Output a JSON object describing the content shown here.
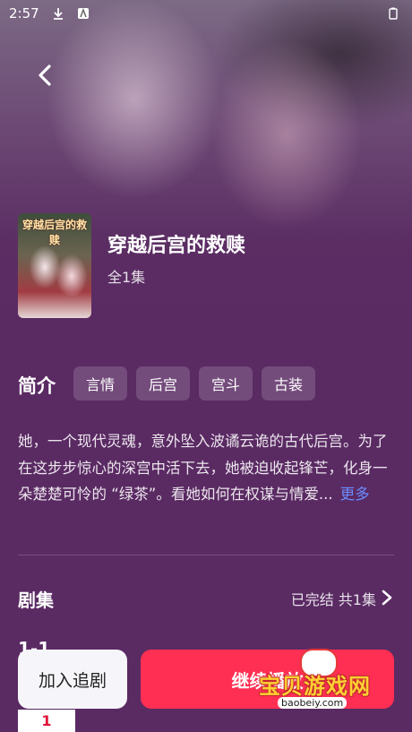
{
  "status": {
    "time": "2:57"
  },
  "drama": {
    "title": "穿越后宫的救赎",
    "cover_title": "穿越后宫的救赎",
    "episodes": "全1集"
  },
  "intro": {
    "label": "简介",
    "tags": [
      "言情",
      "后宫",
      "宫斗",
      "古装"
    ],
    "synopsis": "她，一个现代灵魂，意外坠入波谲云诡的古代后宫。为了在这步步惊心的深宫中活下去，她被迫收起锋芒，化身一朵楚楚可怜的 “绿茶”。看她如何在权谋与情爱...",
    "more": "更多"
  },
  "episodes_section": {
    "label": "剧集",
    "status": "已完结  共1集",
    "range": "1-1",
    "tiles": [
      "1"
    ]
  },
  "actions": {
    "follow": "加入追剧",
    "play": "继续播放"
  },
  "watermark": {
    "text": "宝贝游戏网",
    "url": "baobeiy.com"
  },
  "colors": {
    "accent": "#ff2f53",
    "link": "#6b8cff",
    "background": "#5a2a63"
  }
}
